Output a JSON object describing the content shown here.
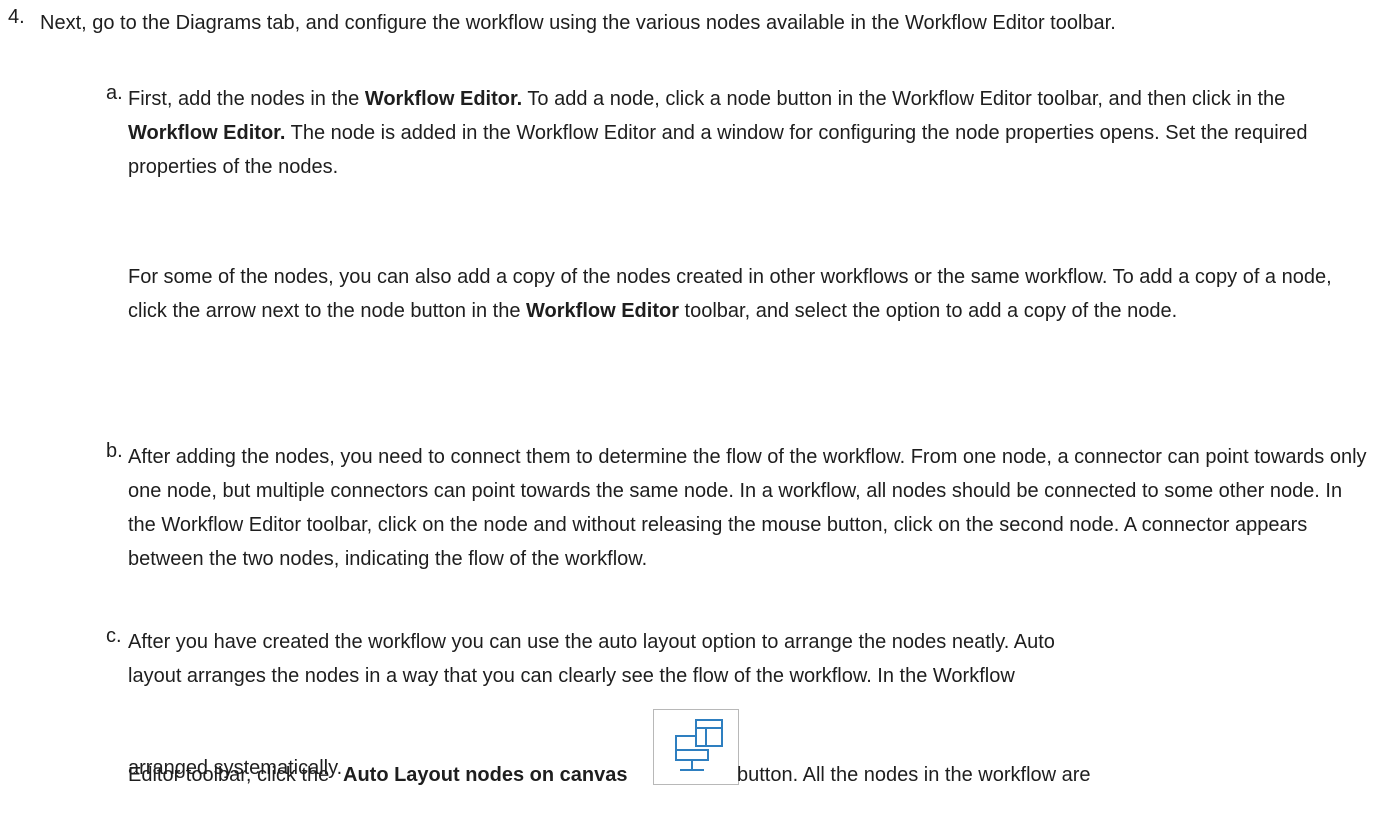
{
  "step4": {
    "marker": "4.",
    "text": "Next, go to the Diagrams tab, and configure the workflow using the various nodes available in the Workflow Editor toolbar."
  },
  "sub_a": {
    "marker": "a.",
    "t1": "First, add the nodes in the ",
    "b1": "Workflow Editor.",
    "t2": " To add a node, click a node button in the Workflow Editor toolbar, and then click in the ",
    "b2": "Workflow Editor.",
    "t3": " The node is added in the Workflow Editor and a window for configuring the node properties opens. Set the required properties of the nodes.",
    "p2_t1": "For some of the nodes, you can also add a copy of the nodes created in other workflows or the same workflow. To add a copy of a node, click the arrow next to the node button in the ",
    "p2_b1": "Workflow Editor",
    "p2_t2": " toolbar, and select the option to add a copy of the node."
  },
  "sub_b": {
    "marker": "b.",
    "text": "After adding the nodes, you need to connect them to determine the flow of the workflow. From one node, a connector can point towards only one node, but multiple connectors can point towards the same node. In a workflow, all nodes should be connected to some other node. In the Workflow Editor toolbar, click on the node and without releasing the mouse button, click on the second node. A connector appears between the two nodes, indicating the flow of the workflow."
  },
  "sub_c": {
    "marker": "c.",
    "line1": "After you have created the workflow you can use the auto layout option to arrange the nodes neatly. Auto",
    "line2": "layout arranges the nodes in a way that you can clearly see the flow of the workflow. In the Workflow",
    "t1": "Editor toolbar, click the ",
    "b1": "Auto Layout nodes on canvas",
    "t2": " button. All the nodes in the workflow are",
    "line4": "arranged systematically.",
    "icon": "auto-layout-icon",
    "icon_color": "#2e7fc0"
  }
}
